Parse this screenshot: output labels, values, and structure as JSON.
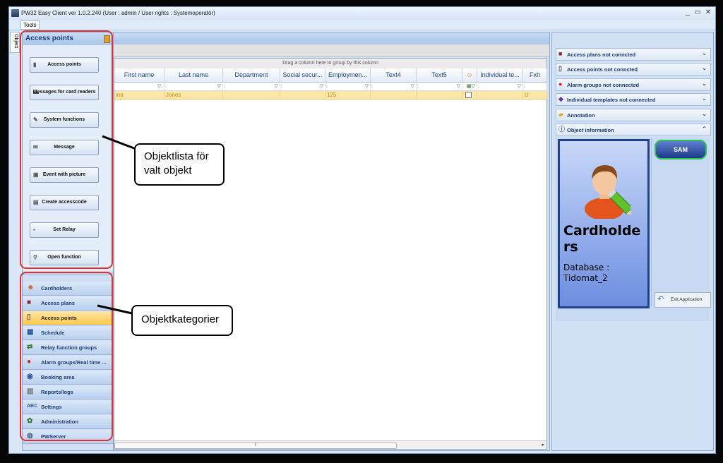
{
  "window": {
    "title": "PW32 Easy Client   ver 1.0.2.240   (User : admin / User rights : Systemoperatör)",
    "controls": [
      "_",
      "▭",
      "✕"
    ]
  },
  "menu": {
    "tools": "Tools"
  },
  "side_tab": {
    "label": "Object"
  },
  "nav": {
    "header": "Access points",
    "functions": [
      {
        "label": "Access points",
        "icon": "door-icon"
      },
      {
        "label": "Messages for card readers",
        "icon": "message-icon"
      },
      {
        "label": "System functions",
        "icon": "gear-icon"
      },
      {
        "label": "Message",
        "icon": "envelope-icon"
      },
      {
        "label": "Event with picture",
        "icon": "picture-icon"
      },
      {
        "label": "Create accesscode",
        "icon": "keypad-icon"
      },
      {
        "label": "Set Relay",
        "icon": "relay-icon"
      },
      {
        "label": "Open function",
        "icon": "open-icon"
      }
    ],
    "categories": [
      {
        "label": "Cardholders",
        "icon": "people-icon",
        "active": false
      },
      {
        "label": "Access plans",
        "icon": "plan-icon",
        "active": false
      },
      {
        "label": "Access points",
        "icon": "door-icon",
        "active": true
      },
      {
        "label": "Schedule",
        "icon": "calendar-icon",
        "active": false
      },
      {
        "label": "Relay function groups",
        "icon": "relay-icon",
        "active": false
      },
      {
        "label": "Alarm groups/Real time ...",
        "icon": "alarm-icon",
        "active": false
      },
      {
        "label": "Booking area",
        "icon": "booking-icon",
        "active": false
      },
      {
        "label": "Reports/logs",
        "icon": "report-icon",
        "active": false
      },
      {
        "label": "Settings",
        "icon": "settings-icon",
        "active": false
      },
      {
        "label": "Administration",
        "icon": "admin-icon",
        "active": false
      },
      {
        "label": "PWServer",
        "icon": "server-icon",
        "active": false
      }
    ]
  },
  "grid": {
    "group_panel": "Drag a column here to group by this column",
    "columns": [
      "First name",
      "Last name",
      "Department",
      "Social secur...",
      "Employmen...",
      "Text4",
      "Text5",
      "",
      "Individual  te...",
      "Fxh"
    ],
    "row": [
      "ina",
      "Jones",
      "",
      "",
      "125",
      "",
      "",
      "",
      "",
      "U"
    ],
    "scroll_label": "⦀"
  },
  "right": {
    "panels": [
      {
        "label": "Access plans not conncted",
        "icon": "plan-icon",
        "chevron": "⌄"
      },
      {
        "label": "Access points not conncted",
        "icon": "door-icon",
        "chevron": "⌄"
      },
      {
        "label": "Alarm groups not connected",
        "icon": "alarm-icon",
        "chevron": "⌄"
      },
      {
        "label": "Individual templates not connected",
        "icon": "template-icon",
        "chevron": "⌄"
      },
      {
        "label": "Annotation",
        "icon": "note-icon",
        "chevron": "⌄"
      },
      {
        "label": "Object information",
        "icon": "info-icon",
        "chevron": "⌃"
      }
    ],
    "card": {
      "title": "Cardholders",
      "database": "Database : Tidomat_2"
    },
    "sam": "SAM",
    "exit": "Exit Application"
  },
  "annotations": {
    "list_callout": [
      "Objektlista för",
      "valt objekt"
    ],
    "category_callout": "Objektkategorier"
  },
  "colors": {
    "highlight": "#e03030",
    "active_category": "#ffc94a",
    "selected_row": "#fde7a4"
  }
}
